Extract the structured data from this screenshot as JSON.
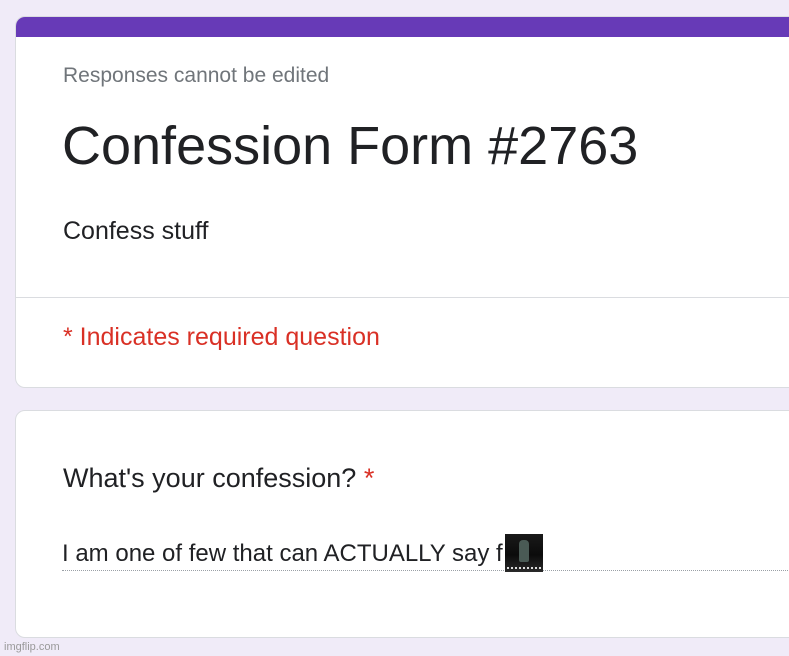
{
  "colors": {
    "accent": "#673ab7",
    "required": "#d93025",
    "background": "#f0ebf8"
  },
  "form": {
    "edit_note": "Responses cannot be edited",
    "title": "Confession Form #2763",
    "description": "Confess stuff",
    "required_note": "* Indicates required question"
  },
  "question": {
    "label": "What's your confession?",
    "required_marker": "*",
    "answer": "I am one of few that can ACTUALLY say f",
    "answer_image_icon": "embedded-image-icon"
  },
  "watermark": "imgflip.com"
}
